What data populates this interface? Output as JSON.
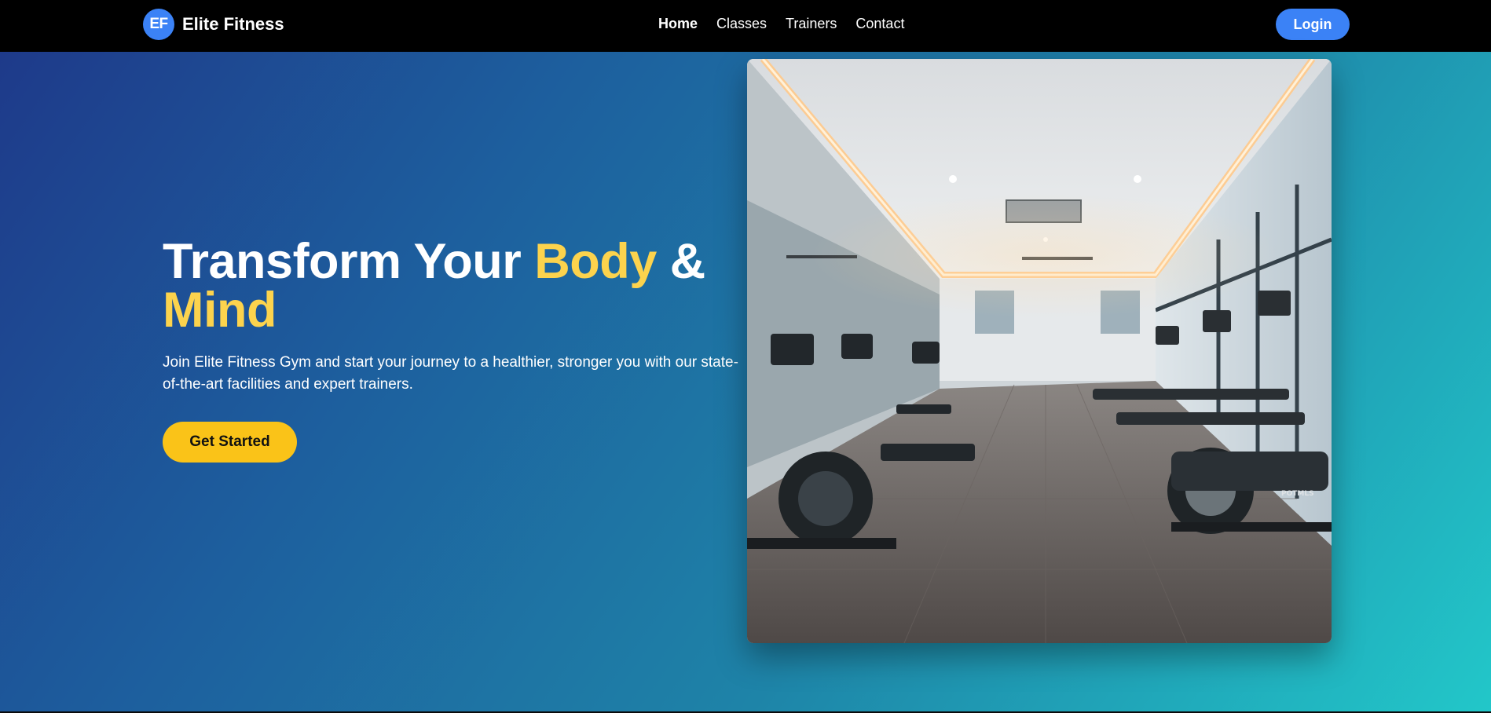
{
  "brand": {
    "logo_text": "EF",
    "name": "Elite Fitness"
  },
  "nav": {
    "links": [
      {
        "label": "Home",
        "active": true
      },
      {
        "label": "Classes",
        "active": false
      },
      {
        "label": "Trainers",
        "active": false
      },
      {
        "label": "Contact",
        "active": false
      }
    ],
    "login_label": "Login"
  },
  "hero": {
    "title_part1": "Transform Your ",
    "title_highlight1": "Body",
    "title_part2": " &",
    "title_highlight2": "Mind",
    "subtitle": "Join Elite Fitness Gym and start your journey to a healthier, stronger you with our state-of-the-art facilities and expert trainers.",
    "cta_label": "Get Started",
    "image_label": "POTMLS"
  },
  "colors": {
    "accent_blue": "#3b82f6",
    "accent_yellow": "#fcd34d",
    "cta_yellow": "#fac318",
    "navbar_bg": "#000000"
  },
  "icons": {
    "logo": "ef-logo-badge"
  }
}
